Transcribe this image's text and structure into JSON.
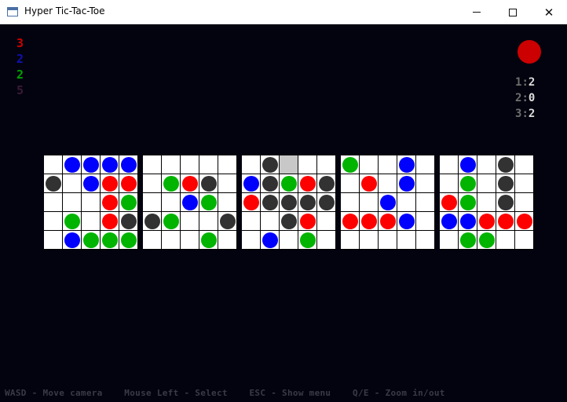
{
  "window": {
    "title": "Hyper Tic-Tac-Toe",
    "controls": {
      "minimize": "—",
      "maximize": "☐",
      "close": "✕"
    }
  },
  "colors": {
    "red": "#ff0000",
    "blue": "#0000ff",
    "green": "#00b400",
    "dark": "#323232",
    "turn": "#cc0000",
    "count_red": "#cc0000",
    "count_blue": "#1010b0",
    "count_green": "#00a000",
    "count_dark": "#3a1a38"
  },
  "counts": [
    {
      "value": "3",
      "color": "count_red"
    },
    {
      "value": "2",
      "color": "count_blue"
    },
    {
      "value": "2",
      "color": "count_green"
    },
    {
      "value": "5",
      "color": "count_dark"
    }
  ],
  "turn_indicator": {
    "color": "turn"
  },
  "scores": [
    {
      "player": "1",
      "sep": ":",
      "score": "2"
    },
    {
      "player": "2",
      "sep": ":",
      "score": "0"
    },
    {
      "player": "3",
      "sep": ":",
      "score": "2"
    }
  ],
  "boards": [
    {
      "rows": [
        [
          "",
          "B",
          "B",
          "B",
          "B"
        ],
        [
          "K",
          "",
          "B",
          "R",
          "R"
        ],
        [
          "",
          "",
          "",
          "R",
          "G"
        ],
        [
          "",
          "G",
          "",
          "R",
          "K"
        ],
        [
          "",
          "B",
          "G",
          "G",
          "G"
        ]
      ]
    },
    {
      "rows": [
        [
          "",
          "",
          "",
          "",
          ""
        ],
        [
          "",
          "G",
          "R",
          "K",
          ""
        ],
        [
          "",
          "",
          "B",
          "G",
          ""
        ],
        [
          "K",
          "G",
          "",
          "",
          "K"
        ],
        [
          "",
          "",
          "",
          "G",
          ""
        ]
      ]
    },
    {
      "rows": [
        [
          "",
          "K",
          "H",
          "",
          ""
        ],
        [
          "B",
          "K",
          "G",
          "R",
          "K"
        ],
        [
          "R",
          "K",
          "K",
          "K",
          "K"
        ],
        [
          "",
          "",
          "K",
          "R",
          ""
        ],
        [
          "",
          "B",
          "",
          "G",
          ""
        ]
      ]
    },
    {
      "rows": [
        [
          "G",
          "",
          "",
          "B",
          ""
        ],
        [
          "",
          "R",
          "",
          "B",
          ""
        ],
        [
          "",
          "",
          "B",
          "",
          ""
        ],
        [
          "R",
          "R",
          "R",
          "B",
          ""
        ],
        [
          "",
          "",
          "",
          "",
          ""
        ]
      ]
    },
    {
      "rows": [
        [
          "",
          "B",
          "",
          "K",
          ""
        ],
        [
          "",
          "G",
          "",
          "K",
          ""
        ],
        [
          "R",
          "G",
          "",
          "K",
          ""
        ],
        [
          "B",
          "B",
          "R",
          "R",
          "R"
        ],
        [
          "",
          "G",
          "G",
          "",
          ""
        ]
      ]
    }
  ],
  "help_text": "WASD - Move camera    Mouse Left - Select    ESC - Show menu    Q/E - Zoom in/out"
}
